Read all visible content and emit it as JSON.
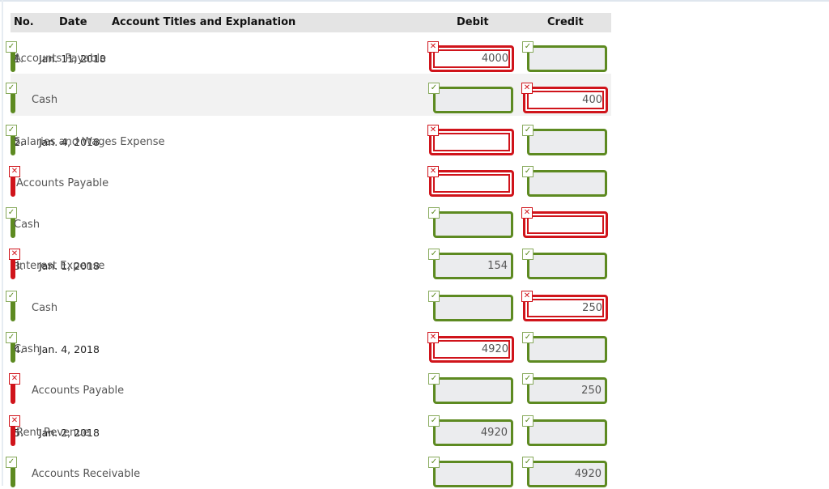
{
  "headers": {
    "no": "No.",
    "date": "Date",
    "account": "Account Titles and Explanation",
    "debit": "Debit",
    "credit": "Credit"
  },
  "icons": {
    "correct": "✓",
    "incorrect": "✕"
  },
  "colors": {
    "correct": "#5d8a21",
    "incorrect": "#d0141b",
    "header_bg": "#e4e4e4"
  },
  "rows": [
    {
      "no": "1.",
      "date": "Jan. 11, 2018",
      "account": "Accounts Payable",
      "account_status": "correct",
      "indent": false,
      "debit": "4000",
      "debit_status": "incorrect",
      "credit": "",
      "credit_status": "correct"
    },
    {
      "no": "",
      "date": "",
      "account": "Cash",
      "account_status": "correct",
      "indent": true,
      "debit": "",
      "debit_status": "correct",
      "credit": "400",
      "credit_status": "incorrect"
    },
    {
      "no": "2.",
      "date": "Jan. 4, 2018",
      "account": "Salaries and Wages Expense",
      "account_status": "correct",
      "indent": false,
      "debit": "",
      "debit_status": "incorrect",
      "credit": "",
      "credit_status": "correct"
    },
    {
      "no": "",
      "date": "",
      "account": "Accounts Payable",
      "account_status": "incorrect",
      "indent": false,
      "debit": "",
      "debit_status": "incorrect",
      "credit": "",
      "credit_status": "correct"
    },
    {
      "no": "",
      "date": "",
      "account": "Cash",
      "account_status": "correct",
      "indent": false,
      "debit": "",
      "debit_status": "correct",
      "credit": "",
      "credit_status": "incorrect"
    },
    {
      "no": "3.",
      "date": "Jan. 1, 2018",
      "account": "Interest Expense",
      "account_status": "incorrect",
      "indent": false,
      "debit": "154",
      "debit_status": "correct",
      "credit": "",
      "credit_status": "correct"
    },
    {
      "no": "",
      "date": "",
      "account": "Cash",
      "account_status": "correct",
      "indent": true,
      "debit": "",
      "debit_status": "correct",
      "credit": "250",
      "credit_status": "incorrect"
    },
    {
      "no": "4.",
      "date": "Jan. 4, 2018",
      "account": "Cash",
      "account_status": "correct",
      "indent": false,
      "debit": "4920",
      "debit_status": "incorrect",
      "credit": "",
      "credit_status": "correct"
    },
    {
      "no": "",
      "date": "",
      "account": "Accounts Payable",
      "account_status": "incorrect",
      "indent": true,
      "debit": "",
      "debit_status": "correct",
      "credit": "250",
      "credit_status": "correct"
    },
    {
      "no": "5.",
      "date": "Jan. 2, 2018",
      "account": "Rent Revenue",
      "account_status": "incorrect",
      "indent": false,
      "debit": "4920",
      "debit_status": "correct",
      "credit": "",
      "credit_status": "correct"
    },
    {
      "no": "",
      "date": "",
      "account": "Accounts Receivable",
      "account_status": "correct",
      "indent": true,
      "debit": "",
      "debit_status": "correct",
      "credit": "4920",
      "credit_status": "correct"
    }
  ]
}
